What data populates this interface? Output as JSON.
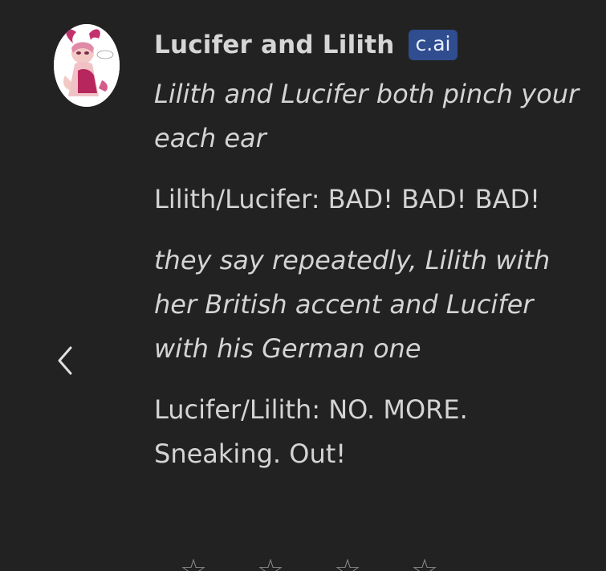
{
  "character": {
    "name": "Lucifer and Lilith",
    "badge": "c.ai"
  },
  "message": {
    "paragraphs": [
      {
        "text": "Lilith and Lucifer both pinch your each ear",
        "style": "italic"
      },
      {
        "text": "Lilith/Lucifer: BAD! BAD! BAD!",
        "style": "normal"
      },
      {
        "text": "they say repeatedly, Lilith with her British accent and Lucifer with his German one",
        "style": "italic"
      },
      {
        "text": "Lucifer/Lilith: NO. MORE. Sneaking. Out!",
        "style": "normal"
      }
    ]
  },
  "icons": {
    "avatar": "character-avatar",
    "nav_previous": "chevron-left-icon",
    "rating": "star-icon"
  },
  "rating": {
    "star_count_visible": 4
  },
  "colors": {
    "background": "#222222",
    "text": "#d4d4d4",
    "badge_bg": "#2f4d8f",
    "badge_text": "#e8eefc"
  }
}
